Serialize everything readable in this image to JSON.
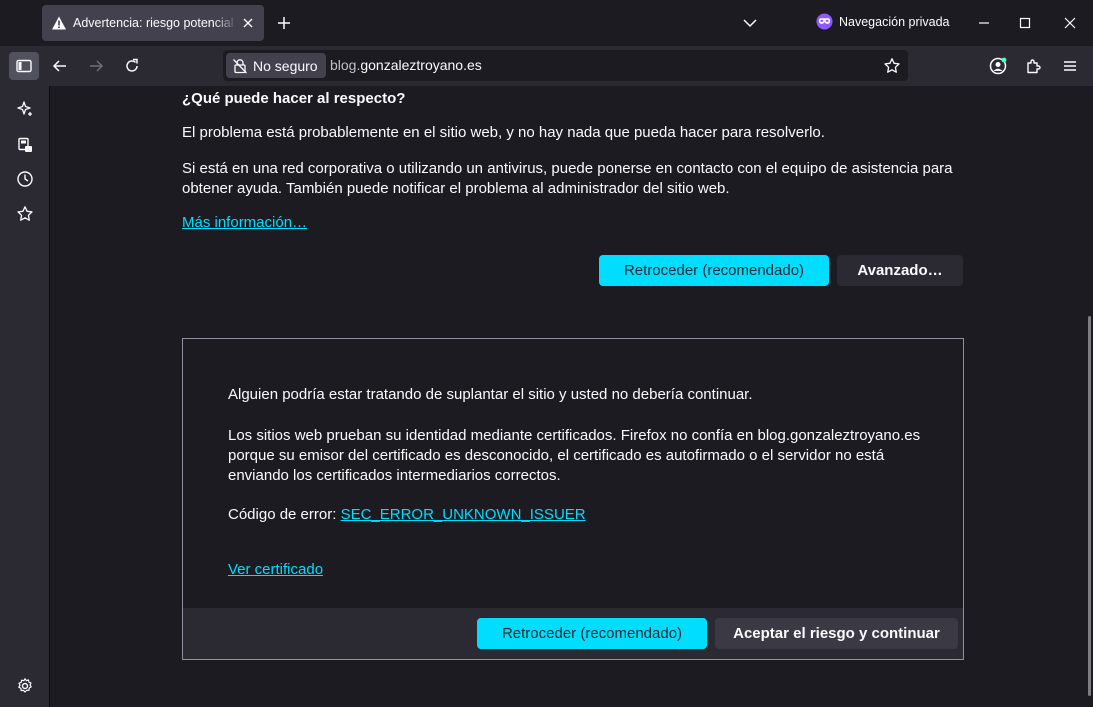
{
  "tab": {
    "title": "Advertencia: riesgo potencial de seguridad a continuación"
  },
  "private": {
    "label": "Navegación privada"
  },
  "urlbar": {
    "security_label": "No seguro",
    "url_prefix": "blog.",
    "url_domain": "gonzaleztroyano.es"
  },
  "page": {
    "heading": "¿Qué puede hacer al respecto?",
    "para1": "El problema está probablemente en el sitio web, y no hay nada que pueda hacer para resolverlo.",
    "para2": "Si está en una red corporativa o utilizando un antivirus, puede ponerse en contacto con el equipo de asistencia para obtener ayuda. También puede notificar el problema al administrador del sitio web.",
    "more_link": "Más información…",
    "back_button": "Retroceder (recomendado)",
    "advanced_button": "Avanzado…"
  },
  "advanced": {
    "text1": "Alguien podría estar tratando de suplantar el sitio y usted no debería continuar.",
    "text2": "Los sitios web prueban su identidad mediante certificados. Firefox no confía en blog.gonzaleztroyano.es porque su emisor del certificado es desconocido, el certificado es autofirmado o el servidor no está enviando los certificados intermediarios correctos.",
    "error_label": "Código de error: ",
    "error_code": "SEC_ERROR_UNKNOWN_ISSUER",
    "view_cert": "Ver certificado",
    "back_button": "Retroceder (recomendado)",
    "accept_button": "Aceptar el riesgo y continuar"
  },
  "colors": {
    "accent": "#00ddff",
    "background": "#1c1b22",
    "toolbar": "#2b2a33",
    "private_purple": "#9059ff"
  }
}
